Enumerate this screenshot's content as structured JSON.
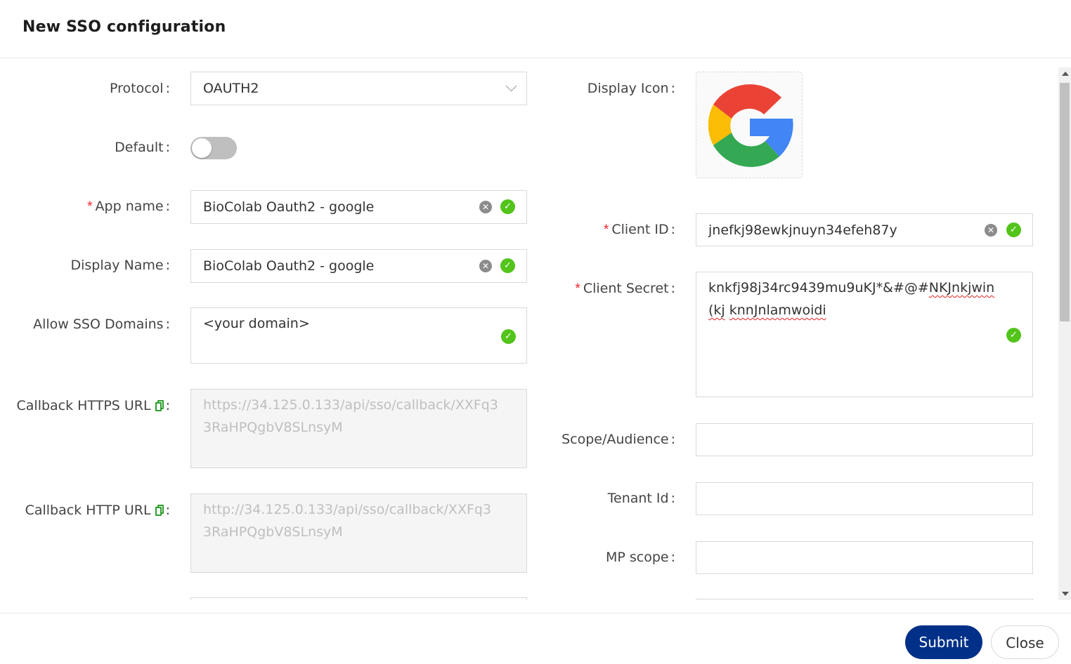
{
  "dialog": {
    "title": "New SSO configuration"
  },
  "left": {
    "protocol": {
      "label": "Protocol",
      "value": "OAUTH2"
    },
    "default": {
      "label": "Default",
      "checked": false
    },
    "app_name": {
      "label": "App name",
      "value": "BioColab Oauth2 - google",
      "required": true
    },
    "display_name": {
      "label": "Display Name",
      "value": "BioColab Oauth2 - google"
    },
    "allow_domains": {
      "label": "Allow SSO Domains",
      "value": "<your domain>"
    },
    "callback_https": {
      "label": "Callback HTTPS URL",
      "value": "https://34.125.0.133/api/sso/callback/XXFq33RaHPQgbV8SLnsyM"
    },
    "callback_http": {
      "label": "Callback HTTP URL",
      "value": "http://34.125.0.133/api/sso/callback/XXFq33RaHPQgbV8SLnsyM"
    }
  },
  "right": {
    "display_icon": {
      "label": "Display Icon",
      "icon": "google-logo",
      "text": "G"
    },
    "client_id": {
      "label": "Client ID",
      "value": "jnefkj98ewkjnuyn34efeh87y",
      "required": true
    },
    "client_secret": {
      "label": "Client Secret",
      "value_plain": "knkfj98j34rc9439mu9uKJ*&#@#",
      "value_mark1": "NKJnkjwin(kj",
      "value_mark2": "knnJnlamwoidi",
      "required": true
    },
    "scope": {
      "label": "Scope/Audience",
      "value": ""
    },
    "tenant": {
      "label": "Tenant Id",
      "value": ""
    },
    "mp_scope": {
      "label": "MP scope",
      "value": ""
    }
  },
  "footer": {
    "submit_label": "Submit",
    "close_label": "Close"
  },
  "colors": {
    "primary": "#003087",
    "success": "#52c41a",
    "required": "#f5222d"
  }
}
